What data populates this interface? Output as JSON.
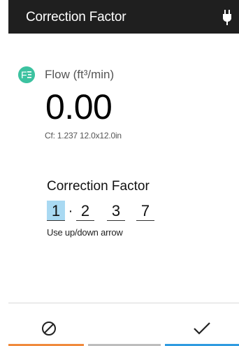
{
  "header": {
    "title": "Correction Factor",
    "plug_icon": "plug-icon"
  },
  "flow": {
    "icon": "flow-icon",
    "icon_glyph": "F",
    "label": "Flow (ft³/min)",
    "value": "0.00",
    "cf_info": "Cf: 1.237 12.0x12.0in"
  },
  "correction": {
    "title": "Correction Factor",
    "digits": [
      "1",
      "2",
      "3",
      "7"
    ],
    "separator": "·",
    "selected_index": 0,
    "hint": "Use up/down arrow"
  },
  "footer": {
    "cancel_icon": "cancel-icon",
    "confirm_icon": "checkmark-icon"
  },
  "colors": {
    "header_bg": "#1f1f1f",
    "flow_icon": "#3cc2a0",
    "selected_digit_bg": "#a9d9f2",
    "cancel_accent": "#f08a3c",
    "middle_accent": "#bdbdbd",
    "confirm_accent": "#2f9be0"
  }
}
